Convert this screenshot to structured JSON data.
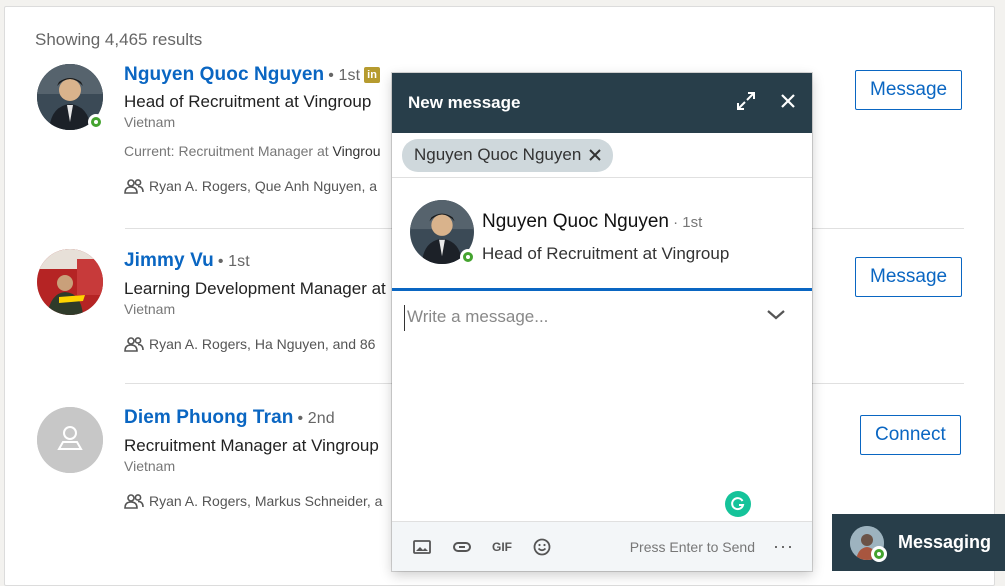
{
  "results": {
    "count_text": "Showing 4,465 results",
    "items": [
      {
        "name": "Nguyen Quoc Nguyen",
        "degree": "• 1st",
        "headline": "Head of Recruitment at Vingroup",
        "location": "Vietnam",
        "current_prefix": "Current: Recruitment Manager at ",
        "current_company": "Vingrou",
        "shared": "Ryan A. Rogers, Que Anh Nguyen, a",
        "action": "Message"
      },
      {
        "name": "Jimmy Vu",
        "degree": "• 1st",
        "headline": "Learning Development Manager at",
        "location": "Vietnam",
        "shared": "Ryan A. Rogers, Ha Nguyen, and 86",
        "action": "Message"
      },
      {
        "name": "Diem Phuong Tran",
        "degree": "• 2nd",
        "headline": "Recruitment Manager at Vingroup",
        "location": "Vietnam",
        "shared": "Ryan A. Rogers, Markus Schneider, a",
        "action": "Connect"
      }
    ]
  },
  "new_message": {
    "title": "New message",
    "recipient": "Nguyen Quoc Nguyen",
    "profile_name": "Nguyen Quoc Nguyen",
    "profile_degree": " · 1st",
    "profile_headline": "Head of Recruitment at Vingroup",
    "placeholder": "Write a message...",
    "footer_hint": "Press Enter to Send",
    "footer_more": "···"
  },
  "messaging_bar": {
    "label": "Messaging"
  },
  "colors": {
    "accent": "#0a66c2",
    "header": "#283e4a",
    "online": "#44a32f"
  }
}
